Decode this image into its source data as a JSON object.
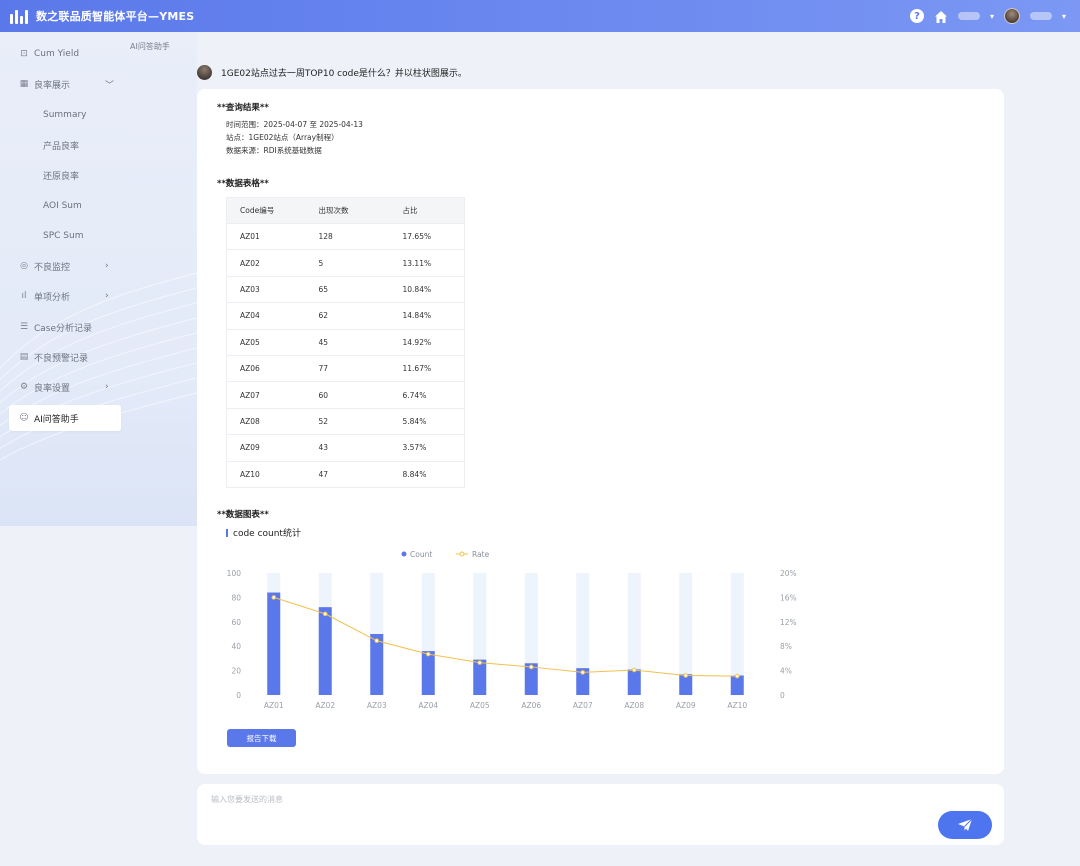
{
  "app": {
    "title": "数之联品质智能体平台—YMES"
  },
  "topbar": {
    "help_icon": "question-circle-icon",
    "home_icon": "home-icon",
    "user_caret": "▾"
  },
  "sidebar": {
    "items": [
      {
        "label": "Cum Yield",
        "icon": "bookmark-icon"
      },
      {
        "label": "良率展示",
        "icon": "calendar-icon",
        "arrow": "﹀"
      },
      {
        "label": "Summary"
      },
      {
        "label": "产品良率"
      },
      {
        "label": "还原良率"
      },
      {
        "label": "AOI Sum"
      },
      {
        "label": "SPC Sum"
      },
      {
        "label": "不良监控",
        "icon": "monitor-icon",
        "arrow": "›"
      },
      {
        "label": "单项分析",
        "icon": "bar-chart-icon",
        "arrow": "›"
      },
      {
        "label": "Case分析记录",
        "icon": "document-icon"
      },
      {
        "label": "不良预警记录",
        "icon": "alert-list-icon"
      },
      {
        "label": "良率设置",
        "icon": "gear-icon",
        "arrow": "›"
      },
      {
        "label": "AI问答助手",
        "icon": "ai-chat-icon"
      }
    ]
  },
  "breadcrumb": "AI问答助手",
  "question": "1GE02站点过去一周TOP10 code是什么？并以柱状图展示。",
  "answer": {
    "result_title": "**查询结果**",
    "time_range": "时间范围：2025-04-07 至 2025-04-13",
    "station": "站点：1GE02站点（Array制程）",
    "source": "数据来源：RDI系统基础数据",
    "table_title": "**数据表格**",
    "table": {
      "headers": [
        "Code编号",
        "出现次数",
        "占比"
      ],
      "rows": [
        [
          "AZ01",
          "128",
          "17.65%"
        ],
        [
          "AZ02",
          "5",
          "13.11%"
        ],
        [
          "AZ03",
          "65",
          "10.84%"
        ],
        [
          "AZ04",
          "62",
          "14.84%"
        ],
        [
          "AZ05",
          "45",
          "14.92%"
        ],
        [
          "AZ06",
          "77",
          "11.67%"
        ],
        [
          "AZ07",
          "60",
          "6.74%"
        ],
        [
          "AZ08",
          "52",
          "5.84%"
        ],
        [
          "AZ09",
          "43",
          "3.57%"
        ],
        [
          "AZ10",
          "47",
          "8.84%"
        ]
      ]
    },
    "chart_section_title": "**数据图表**",
    "download_label": "报告下载"
  },
  "chart_data": {
    "type": "bar",
    "title": "code count统计",
    "categories": [
      "AZ01",
      "AZ02",
      "AZ03",
      "AZ04",
      "AZ05",
      "AZ06",
      "AZ07",
      "AZ08",
      "AZ09",
      "AZ10"
    ],
    "series": [
      {
        "name": "Count",
        "type": "bar",
        "axis": "left",
        "values": [
          84,
          72,
          50,
          36,
          29,
          26,
          22,
          21,
          17,
          16
        ]
      },
      {
        "name": "Rate",
        "type": "line",
        "axis": "right",
        "values": [
          16,
          13.3,
          8.9,
          6.7,
          5.3,
          4.6,
          3.7,
          4.1,
          3.2,
          3.1
        ]
      }
    ],
    "ylim_left": [
      0,
      100
    ],
    "ylim_right": [
      0,
      20
    ],
    "yticks_left": [
      "0",
      "20",
      "40",
      "60",
      "80",
      "100"
    ],
    "yticks_right": [
      "0",
      "4%",
      "8%",
      "12%",
      "16%",
      "20%"
    ],
    "legend": "top-center",
    "colors": {
      "bar": "#5b78ea",
      "bar_background": "#eef4fc",
      "line": "#f2c14e"
    }
  },
  "input": {
    "placeholder": "输入您要发送的消息",
    "value": ""
  },
  "colors": {
    "accent": "#5b78ea",
    "send": "#4f74ef"
  }
}
